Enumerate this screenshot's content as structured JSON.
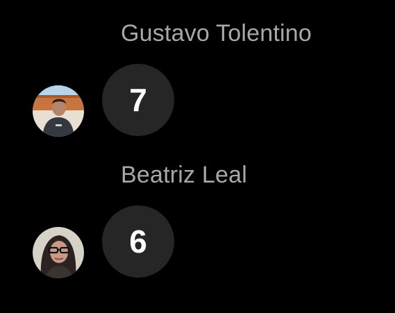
{
  "messages": [
    {
      "sender": "Gustavo Tolentino",
      "avatar_icon": "user-avatar-photo",
      "text": "7"
    },
    {
      "sender": "Beatriz Leal",
      "avatar_icon": "user-avatar-photo",
      "text": "6"
    }
  ],
  "colors": {
    "background": "#000000",
    "bubble": "#262626",
    "sender_name": "#a8a8a8",
    "message_text": "#ffffff"
  }
}
